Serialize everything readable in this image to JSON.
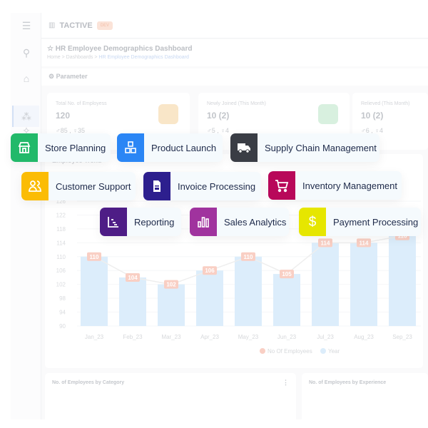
{
  "app": {
    "brand": "TACTIVE",
    "badge": "DEV"
  },
  "page": {
    "title": "HR Employee Demographics Dashboard",
    "breadcrumb": [
      "Home",
      "Dashboards",
      "HR Employee Demographics Dashboard"
    ]
  },
  "parameter_label": "Parameter",
  "cards": [
    {
      "label": "Total No. of Employess",
      "value": "120",
      "male": "85",
      "female": "35",
      "icon": "users-icon",
      "color": "#f9e6c8"
    },
    {
      "label": "Newly Joined (This Month)",
      "value": "10 (2)",
      "male": "5",
      "female": "4",
      "icon": "user-plus-icon",
      "color": "#d8f0df"
    },
    {
      "label": "Relieved (This Month)",
      "value": "10 (2)",
      "male": "6",
      "female": "4",
      "icon": "user-minus-icon",
      "color": "#fde0e0"
    }
  ],
  "chart_data": {
    "type": "bar",
    "title": "Employee Trend",
    "categories": [
      "Jan_23",
      "Feb_23",
      "Mar_23",
      "Apr_23",
      "May_23",
      "Jun_23",
      "Jul_23",
      "Aug_23",
      "Sep_23"
    ],
    "series": [
      {
        "name": "No Of Employees",
        "type": "line",
        "values": [
          110,
          104,
          102,
          106,
          110,
          105,
          114,
          114,
          116
        ],
        "color": "#f9cfc4"
      },
      {
        "name": "Year",
        "type": "bar",
        "values": [
          110,
          104,
          102,
          106,
          110,
          105,
          114,
          114,
          116
        ],
        "color": "#dcedfb"
      }
    ],
    "yticks": [
      90,
      94,
      98,
      102,
      106,
      110,
      114,
      118,
      122,
      126
    ],
    "ylim": [
      90,
      126
    ],
    "grid": true,
    "legend": "bottom"
  },
  "bottom_cards": [
    "No. of Employees by Category",
    "No. of Employees by Experience"
  ],
  "chips": [
    {
      "label": "Store Planning",
      "icon": "store-icon",
      "color": "#22b96a"
    },
    {
      "label": "Product Launch",
      "icon": "boxes-icon",
      "color": "#2b86f5"
    },
    {
      "label": "Supply Chain Management",
      "icon": "truck-icon",
      "color": "#3a3d45"
    },
    {
      "label": "Customer Support",
      "icon": "customer-support-icon",
      "color": "#fbbc05"
    },
    {
      "label": "Invoice Processing",
      "icon": "invoice-icon",
      "color": "#2d1f8e"
    },
    {
      "label": "Inventory Management",
      "icon": "cart-icon",
      "color": "#b8085a"
    },
    {
      "label": "Reporting",
      "icon": "report-icon",
      "color": "#4e1d86"
    },
    {
      "label": "Sales Analytics",
      "icon": "bar-chart-icon",
      "color": "#a0339e"
    },
    {
      "label": "Payment Processing",
      "icon": "dollar-icon",
      "color": "#e6e600"
    }
  ]
}
